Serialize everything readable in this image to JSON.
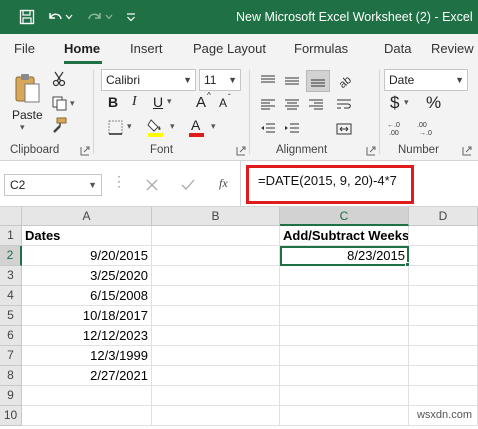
{
  "window": {
    "title": "New Microsoft Excel Worksheet (2)  -  Excel"
  },
  "ribbon_tabs": [
    {
      "label": "File"
    },
    {
      "label": "Home"
    },
    {
      "label": "Insert"
    },
    {
      "label": "Page Layout"
    },
    {
      "label": "Formulas"
    },
    {
      "label": "Data"
    },
    {
      "label": "Review"
    }
  ],
  "ribbon": {
    "clipboard": {
      "paste_label": "Paste",
      "group_label": "Clipboard"
    },
    "font": {
      "font_name": "Calibri",
      "font_size": "11",
      "bold": "B",
      "italic": "I",
      "underline": "U",
      "grow": "A",
      "shrink": "A",
      "font_color": "A",
      "group_label": "Font"
    },
    "alignment": {
      "group_label": "Alignment"
    },
    "number": {
      "format": "Date",
      "currency": "$",
      "percent": "%",
      "group_label": "Number"
    }
  },
  "formula_bar": {
    "name_box": "C2",
    "fx": "fx",
    "formula": "=DATE(2015, 9, 20)-4*7"
  },
  "sheet": {
    "columns": [
      "A",
      "B",
      "C",
      "D"
    ],
    "rows": [
      "1",
      "2",
      "3",
      "4",
      "5",
      "6",
      "7",
      "8",
      "9",
      "10"
    ],
    "cells": {
      "A1": "Dates",
      "A2": "9/20/2015",
      "A3": "3/25/2020",
      "A4": "6/15/2008",
      "A5": "10/18/2017",
      "A6": "12/12/2023",
      "A7": "12/3/1999",
      "A8": "2/27/2021",
      "C1": "Add/Subtract Weeks",
      "C2": "8/23/2015"
    },
    "selected_cell": "C2"
  },
  "colors": {
    "excel_green": "#1f7145",
    "highlight_red": "#e01b1b",
    "fill_yellow": "#ffff00",
    "font_red": "#e01b1b"
  },
  "watermark": "wsxdn.com"
}
